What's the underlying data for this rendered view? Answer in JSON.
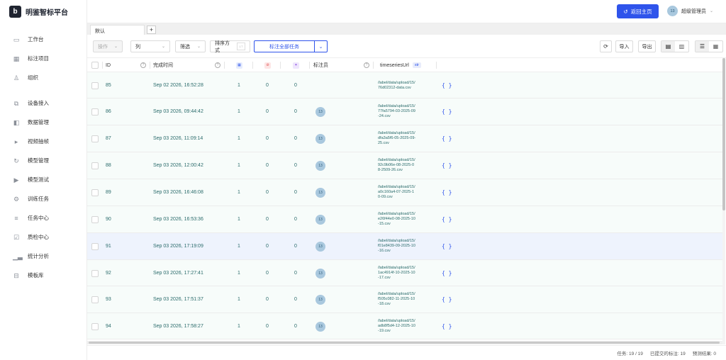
{
  "brand": {
    "logo": "b",
    "name": "明鉴智标平台"
  },
  "sidebar": {
    "items": [
      {
        "label": "工作台",
        "icon": "monitor-icon"
      },
      {
        "label": "标注项目",
        "icon": "grid-icon"
      },
      {
        "label": "组织",
        "icon": "org-icon"
      },
      {
        "label": "设备接入",
        "icon": "device-icon"
      },
      {
        "label": "数据管理",
        "icon": "data-icon"
      },
      {
        "label": "视频抽帧",
        "icon": "play-icon"
      },
      {
        "label": "模型管理",
        "icon": "model-icon"
      },
      {
        "label": "模型测试",
        "icon": "test-icon"
      },
      {
        "label": "训练任务",
        "icon": "train-icon"
      },
      {
        "label": "任务中心",
        "icon": "list-icon"
      },
      {
        "label": "质检中心",
        "icon": "check-icon"
      },
      {
        "label": "统计分析",
        "icon": "chart-icon"
      },
      {
        "label": "模板库",
        "icon": "book-icon"
      }
    ]
  },
  "topbar": {
    "home_label": "返回主页",
    "user_avatar": "13",
    "user_name": "超级管理员"
  },
  "tabs": {
    "active": "默认",
    "add": "+"
  },
  "toolbar": {
    "actions_label": "操作",
    "columns_label": "列",
    "filter_label": "筛选",
    "sort_label": "排序方式",
    "label_all_label": "标注全部任务",
    "import_label": "导入",
    "export_label": "导出"
  },
  "table": {
    "headers": {
      "id": "ID",
      "completed": "完成时间",
      "annotators": "标注员",
      "url": "timeseriesUrl",
      "url_type": "str"
    },
    "rows": [
      {
        "id": "85",
        "time": "Sep 02 2026, 16:52:28",
        "c1": "1",
        "c2": "0",
        "c3": "0",
        "annotator": "",
        "url": "/label/data/upload/15/76d02312-data.csv",
        "json": "{}"
      },
      {
        "id": "86",
        "time": "Sep 03 2026, 09:44:42",
        "c1": "1",
        "c2": "0",
        "c3": "0",
        "annotator": "13",
        "url": "/label/data/upload/15/77fa5794-03-2025-09-24.csv",
        "json": "{}"
      },
      {
        "id": "87",
        "time": "Sep 03 2026, 11:09:14",
        "c1": "1",
        "c2": "0",
        "c3": "0",
        "annotator": "13",
        "url": "/label/data/upload/15/dfa3a5f6-05-2025-09-25.csv",
        "json": "{}"
      },
      {
        "id": "88",
        "time": "Sep 03 2026, 12:00:42",
        "c1": "1",
        "c2": "0",
        "c3": "0",
        "annotator": "13",
        "url": "/label/data/upload/15/92c9b06e-08-2025-08-2509-26.csv",
        "json": "{}"
      },
      {
        "id": "89",
        "time": "Sep 03 2026, 16:46:08",
        "c1": "1",
        "c2": "0",
        "c3": "0",
        "annotator": "13",
        "url": "/label/data/upload/15/a0c160a4-07-2025-10-09.csv",
        "json": "{}"
      },
      {
        "id": "90",
        "time": "Sep 03 2026, 16:53:36",
        "c1": "1",
        "c2": "0",
        "c3": "0",
        "annotator": "13",
        "url": "/label/data/upload/15/e26f44e0-08-2025-10-15.csv",
        "json": "{}"
      },
      {
        "id": "91",
        "time": "Sep 03 2026, 17:19:09",
        "c1": "1",
        "c2": "0",
        "c3": "0",
        "annotator": "13",
        "url": "/label/data/upload/15/f01e8439-09-2025-10-16.csv",
        "json": "{}"
      },
      {
        "id": "92",
        "time": "Sep 03 2026, 17:27:41",
        "c1": "1",
        "c2": "0",
        "c3": "0",
        "annotator": "13",
        "url": "/label/data/upload/15/1ac4914f-10-2025-10-17.csv",
        "json": "{}"
      },
      {
        "id": "93",
        "time": "Sep 03 2026, 17:51:37",
        "c1": "1",
        "c2": "0",
        "c3": "0",
        "annotator": "13",
        "url": "/label/data/upload/15/f505c082-11-2025-10-18.csv",
        "json": "{}"
      },
      {
        "id": "94",
        "time": "Sep 03 2026, 17:58:27",
        "c1": "1",
        "c2": "0",
        "c3": "0",
        "annotator": "13",
        "url": "/label/data/upload/15/adb8f5d4-12-2025-10-19.csv",
        "json": "{}"
      }
    ]
  },
  "footer": {
    "tasks": "任务: 19 / 19",
    "submitted": "已提交的标注: 19",
    "predictions": "预测结果: 0"
  },
  "colors": {
    "primary": "#2f54eb",
    "row_bg": "#f7fcfa",
    "row_highlight": "#eef3fd",
    "avatar": "#a9c8de"
  }
}
